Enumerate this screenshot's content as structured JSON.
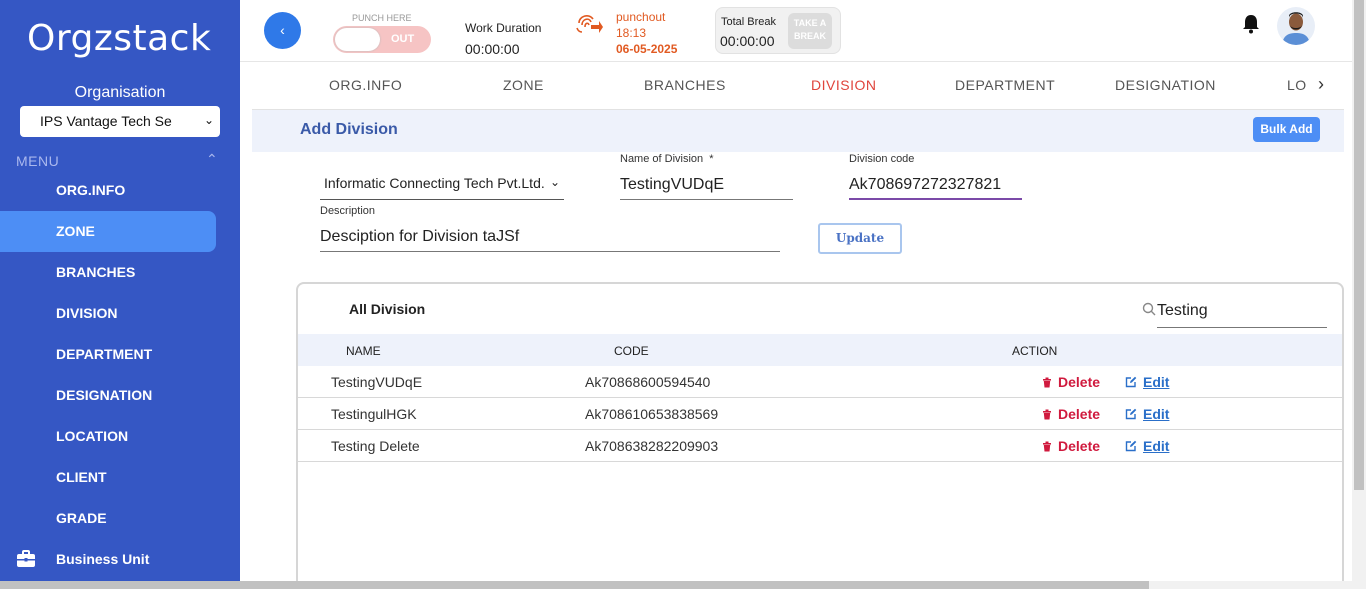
{
  "sidebar": {
    "logo": "Orgzstack",
    "org_label": "Organisation",
    "org_selected": "IPS Vantage Tech Se",
    "menu_label": "MENU",
    "items": [
      {
        "label": "ORG.INFO"
      },
      {
        "label": "ZONE"
      },
      {
        "label": "BRANCHES"
      },
      {
        "label": "DIVISION"
      },
      {
        "label": "DEPARTMENT"
      },
      {
        "label": "DESIGNATION"
      },
      {
        "label": "LOCATION"
      },
      {
        "label": "CLIENT"
      },
      {
        "label": "GRADE"
      },
      {
        "label": "Business Unit",
        "icon": "briefcase-icon"
      }
    ],
    "active_item": "ZONE"
  },
  "topbar": {
    "back_icon": "chevron-left-icon",
    "punch_here": "PUNCH HERE",
    "punch_toggle": "OUT",
    "work_duration_label": "Work Duration",
    "work_duration_value": "00:00:00",
    "fingerprint_icon": "fingerprint-icon",
    "punchout_label": "punchout",
    "punchout_time": "18:13",
    "punchout_date": "06-05-2025",
    "total_break_label": "Total Break",
    "total_break_value": "00:00:00",
    "take_break_line1": "TAKE A",
    "take_break_line2": "BREAK",
    "notification_icon": "bell-icon"
  },
  "tabs": {
    "items": [
      "ORG.INFO",
      "ZONE",
      "BRANCHES",
      "DIVISION",
      "DEPARTMENT",
      "DESIGNATION",
      "LO"
    ],
    "active": "DIVISION",
    "active_color": "#e0443c"
  },
  "form": {
    "title": "Add Division",
    "bulk_add": "Bulk Add",
    "company_selected": "Informatic Connecting Tech Pvt.Ltd.",
    "name_label": "Name of Division",
    "name_required": "*",
    "name_value": "TestingVUDqE",
    "code_label": "Division code",
    "code_value": "Ak70869727232782​1",
    "description_label": "Description",
    "description_value": "Desciption for Division taJSf",
    "update_button": "Update"
  },
  "table": {
    "title": "All Division",
    "search_value": "Testing",
    "columns": [
      "NAME",
      "CODE",
      "ACTION"
    ],
    "rows": [
      {
        "name": "TestingVUDqE",
        "code": "Ak70868600594540",
        "delete": "Delete",
        "edit": "Edit"
      },
      {
        "name": "TestingulHGK",
        "code": "Ak708610653838569",
        "delete": "Delete",
        "edit": "Edit"
      },
      {
        "name": "Testing Delete",
        "code": "Ak708638282209903",
        "delete": "Delete",
        "edit": "Edit"
      }
    ]
  },
  "colors": {
    "sidebar_bg": "#3557c4",
    "active_nav": "#4d8ef5",
    "punchout": "#e15a22",
    "delete": "#d01a3e",
    "edit": "#2a6fc9"
  }
}
